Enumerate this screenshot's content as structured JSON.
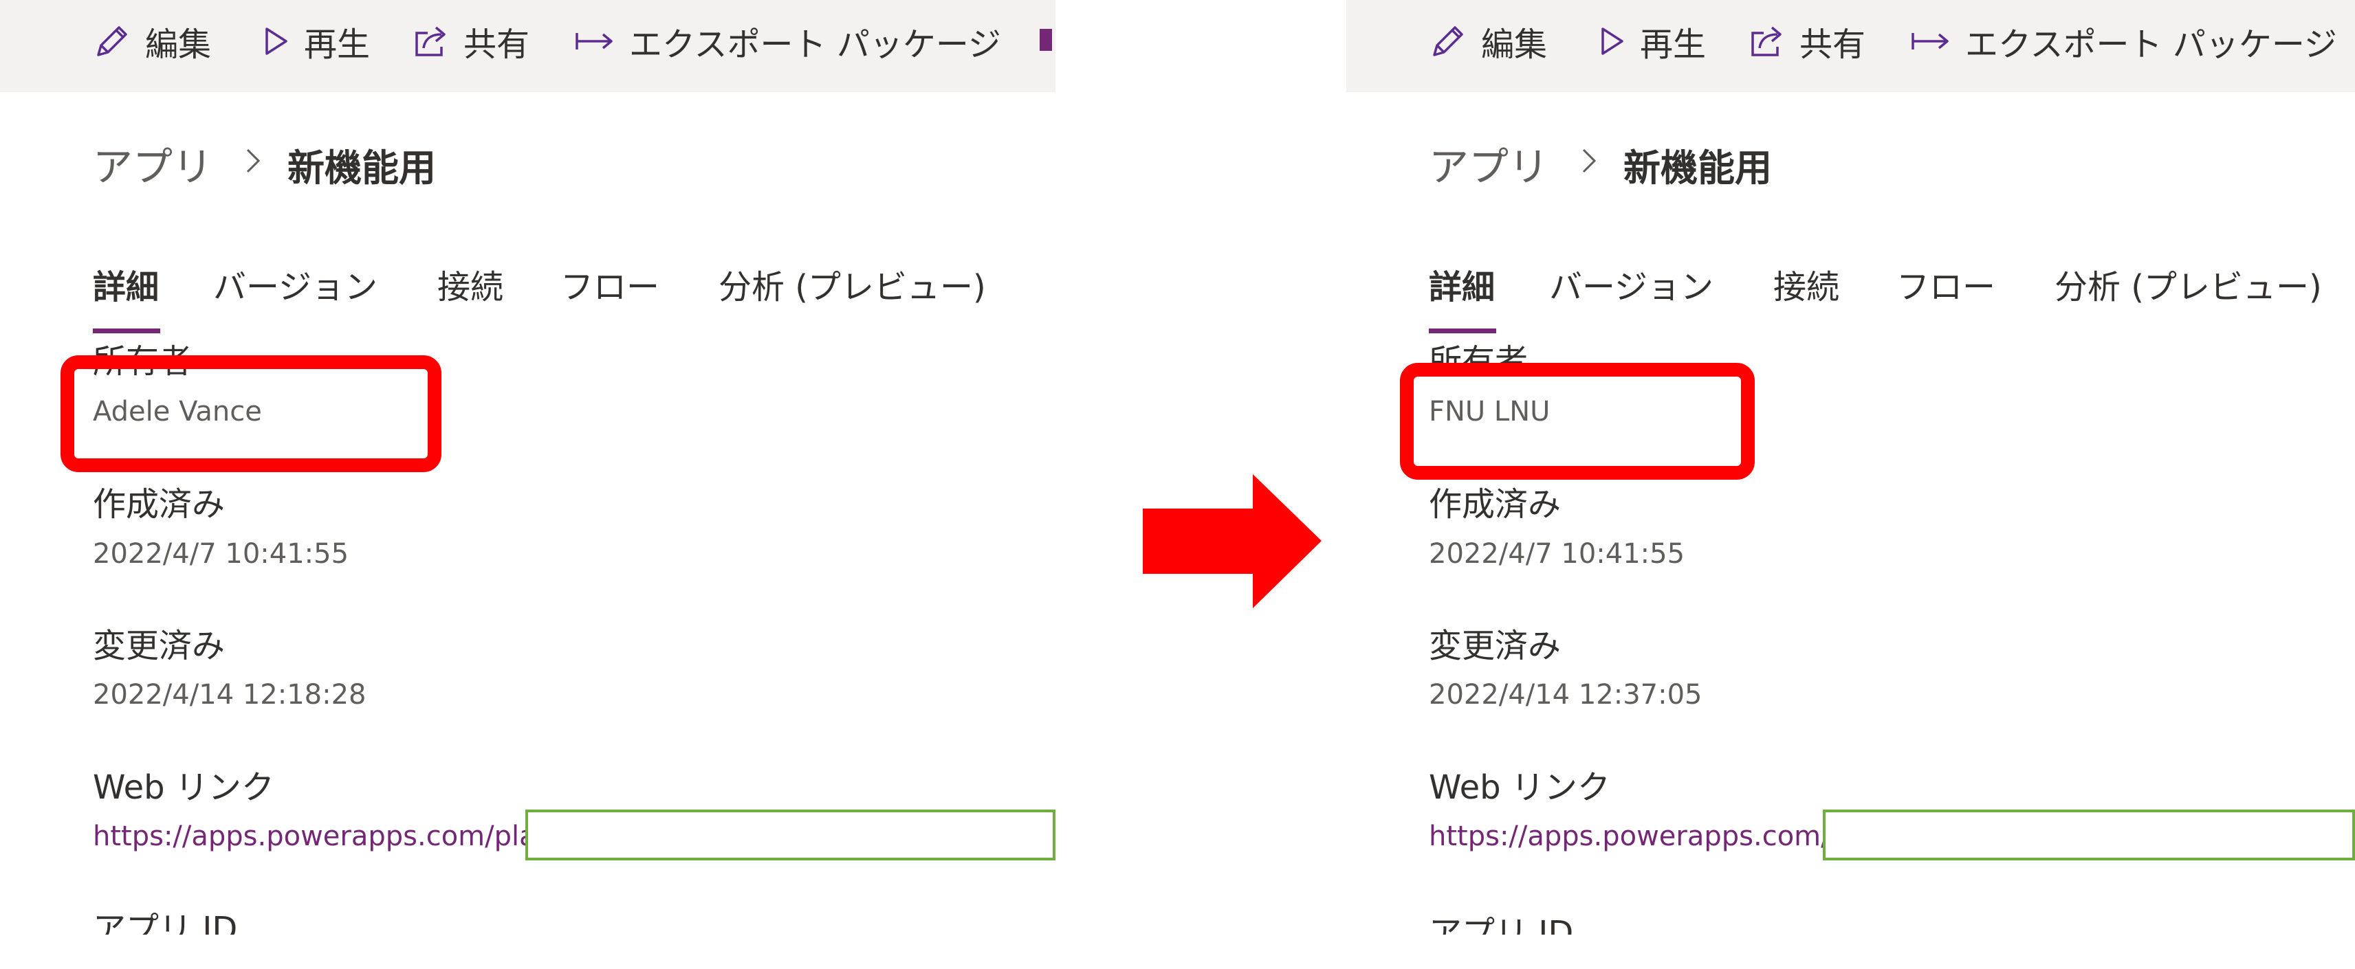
{
  "toolbar": {
    "edit": "編集",
    "play": "再生",
    "share": "共有",
    "export": "エクスポート パッケージ"
  },
  "breadcrumb": {
    "parent": "アプリ",
    "current": "新機能用"
  },
  "tabs": [
    "詳細",
    "バージョン",
    "接続",
    "フロー",
    "分析 (プレビュー)"
  ],
  "labels": {
    "owner": "所有者",
    "created": "作成済み",
    "modified": "変更済み",
    "web_link": "Web リンク",
    "app_id": "アプリ ID"
  },
  "before": {
    "owner": "Adele Vance",
    "created": "2022/4/7 10:41:55",
    "modified": "2022/4/14 12:18:28",
    "web_link": "https://apps.powerapps.com/play/"
  },
  "after": {
    "owner": "FNU LNU",
    "created": "2022/4/7 10:41:55",
    "modified": "2022/4/14 12:37:05",
    "web_link": "https://apps.powerapps.com/pl"
  },
  "colors": {
    "accent": "#742774",
    "highlight": "#ff0000",
    "redaction_border": "#6fae3f",
    "toolbar_bg": "#f3f2f1"
  },
  "icons": [
    "edit-icon",
    "play-icon",
    "share-icon",
    "export-icon",
    "chevron-right-icon",
    "arrow-right-icon"
  ]
}
